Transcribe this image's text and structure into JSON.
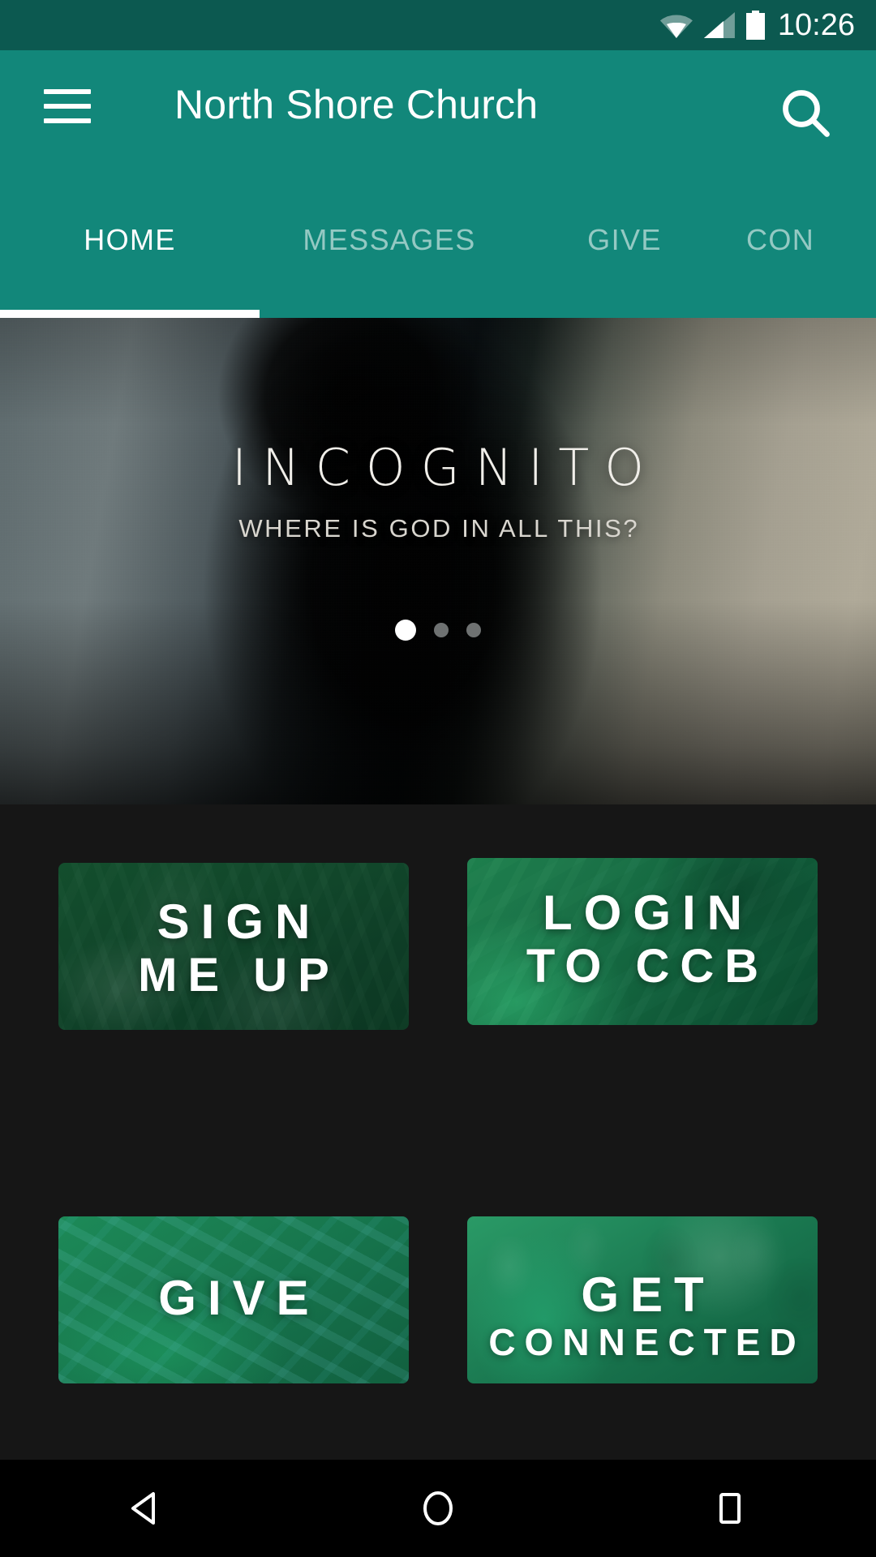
{
  "statusbar": {
    "time": "10:26",
    "icons": [
      "wifi-icon",
      "cell-signal-icon",
      "battery-icon"
    ]
  },
  "header": {
    "menu_icon": "hamburger-menu-icon",
    "title": "North Shore Church",
    "search_icon": "search-icon",
    "accent_color": "#12877a",
    "statusbar_color": "#0c5950",
    "tabs": [
      {
        "label": "HOME",
        "active": true
      },
      {
        "label": "MESSAGES",
        "active": false
      },
      {
        "label": "GIVE",
        "active": false
      },
      {
        "label": "CON",
        "active": false
      }
    ]
  },
  "hero": {
    "title": "INCOGNITO",
    "subtitle": "WHERE IS GOD IN ALL THIS?",
    "dots": [
      {
        "active": true
      },
      {
        "active": false
      },
      {
        "active": false
      }
    ]
  },
  "tiles": [
    {
      "line1": "SIGN",
      "line2": "ME UP",
      "name": "sign-me-up"
    },
    {
      "line1": "LOGIN",
      "line2": "TO CCB",
      "name": "login-to-ccb"
    },
    {
      "line1": "GIVE",
      "line2": "",
      "name": "give"
    },
    {
      "line1": "GET",
      "line2": "CONNECTED",
      "name": "get-connected"
    }
  ],
  "navbar": {
    "back": "back-triangle-icon",
    "home": "home-circle-icon",
    "recents": "recents-square-icon"
  }
}
